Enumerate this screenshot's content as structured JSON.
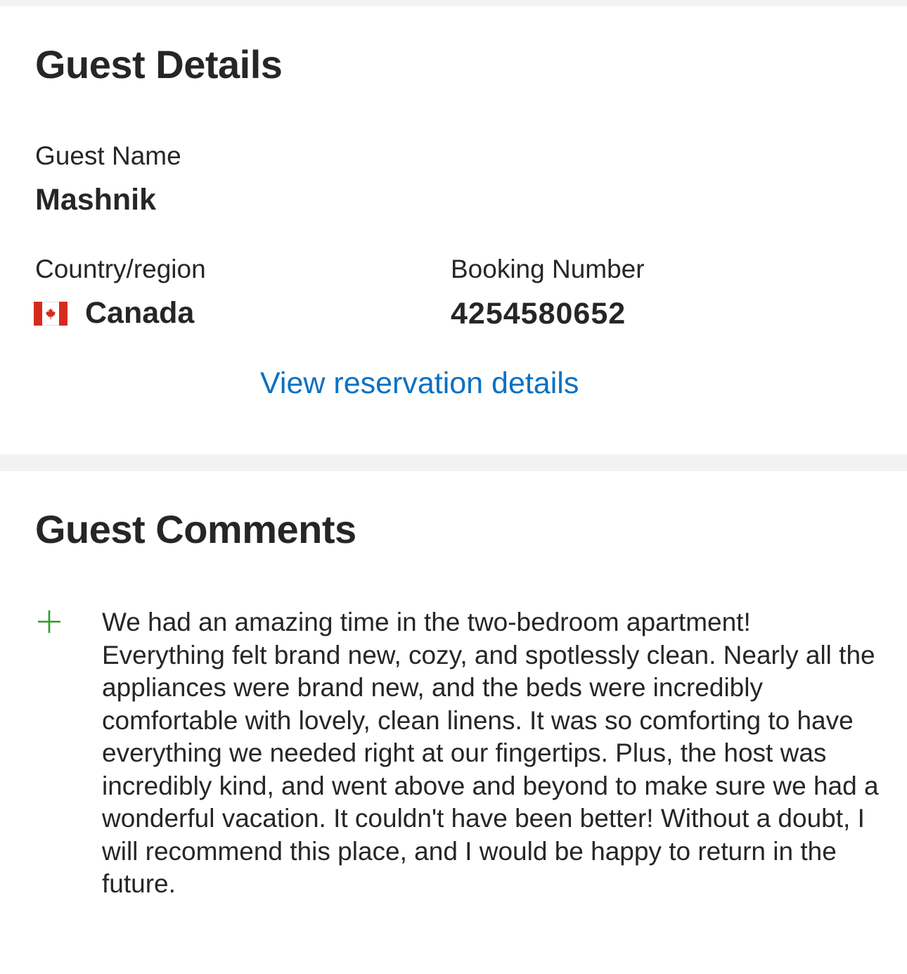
{
  "guest_details": {
    "title": "Guest Details",
    "guest_name_label": "Guest Name",
    "guest_name": "Mashnik",
    "country_label": "Country/region",
    "country": "Canada",
    "country_flag_icon": "canada-flag-icon",
    "booking_number_label": "Booking Number",
    "booking_number": "4254580652",
    "view_reservation_link": "View reservation details"
  },
  "guest_comments": {
    "title": "Guest Comments",
    "positive_icon": "plus-icon",
    "positive_comment": "We had an amazing time in the two-bedroom apartment! Everything felt brand new, cozy, and spotlessly clean. Nearly all the appliances were brand new, and the beds were incredibly comfortable with lovely, clean linens. It was so comforting to have everything we needed right at our fingertips. Plus, the host was incredibly kind, and went above and beyond to make sure we had a wonderful vacation. It couldn't have been better! Without a doubt, I will recommend this place, and I would be happy to return in the future."
  },
  "colors": {
    "text": "#262626",
    "link": "#0a71c2",
    "positive": "#2a9d2a",
    "divider": "#f2f2f2",
    "flag_red": "#d52b1e"
  }
}
